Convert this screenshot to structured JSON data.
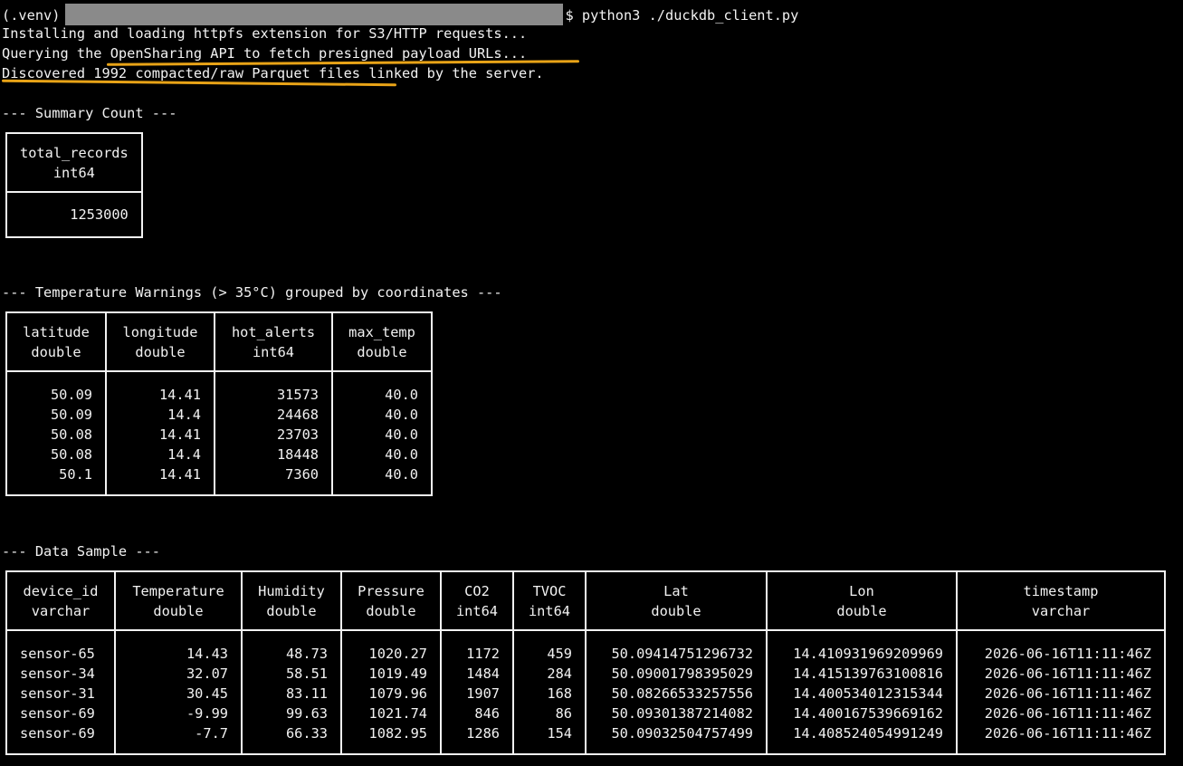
{
  "terminal": {
    "prompt_prefix": "(.venv)",
    "prompt_suffix": "$",
    "command": "python3 ./duckdb_client.py",
    "log_lines": [
      "Installing and loading httpfs extension for S3/HTTP requests...",
      "Querying the OpenSharing API to fetch presigned payload URLs...",
      "Discovered 1992 compacted/raw Parquet files linked by the server."
    ],
    "highlight_color": "#e8a317"
  },
  "summary": {
    "heading": "--- Summary Count ---",
    "column": {
      "name": "total_records",
      "type": "int64"
    },
    "value": "1253000"
  },
  "warnings": {
    "heading": "--- Temperature Warnings (> 35°C) grouped by coordinates ---",
    "columns": [
      {
        "name": "latitude",
        "type": "double"
      },
      {
        "name": "longitude",
        "type": "double"
      },
      {
        "name": "hot_alerts",
        "type": "int64"
      },
      {
        "name": "max_temp",
        "type": "double"
      }
    ],
    "rows": [
      [
        "50.09",
        "14.41",
        "31573",
        "40.0"
      ],
      [
        "50.09",
        "14.4",
        "24468",
        "40.0"
      ],
      [
        "50.08",
        "14.41",
        "23703",
        "40.0"
      ],
      [
        "50.08",
        "14.4",
        "18448",
        "40.0"
      ],
      [
        "50.1",
        "14.41",
        "7360",
        "40.0"
      ]
    ]
  },
  "sample": {
    "heading": "--- Data Sample ---",
    "columns": [
      {
        "name": "device_id",
        "type": "varchar"
      },
      {
        "name": "Temperature",
        "type": "double"
      },
      {
        "name": "Humidity",
        "type": "double"
      },
      {
        "name": "Pressure",
        "type": "double"
      },
      {
        "name": "CO2",
        "type": "int64"
      },
      {
        "name": "TVOC",
        "type": "int64"
      },
      {
        "name": "Lat",
        "type": "double"
      },
      {
        "name": "Lon",
        "type": "double"
      },
      {
        "name": "timestamp",
        "type": "varchar"
      }
    ],
    "rows": [
      [
        "sensor-65",
        "14.43",
        "48.73",
        "1020.27",
        "1172",
        "459",
        "50.09414751296732",
        "14.410931969209969",
        "2026-06-16T11:11:46Z"
      ],
      [
        "sensor-34",
        "32.07",
        "58.51",
        "1019.49",
        "1484",
        "284",
        "50.09001798395029",
        "14.415139763100816",
        "2026-06-16T11:11:46Z"
      ],
      [
        "sensor-31",
        "30.45",
        "83.11",
        "1079.96",
        "1907",
        "168",
        "50.08266533257556",
        "14.400534012315344",
        "2026-06-16T11:11:46Z"
      ],
      [
        "sensor-69",
        "-9.99",
        "99.63",
        "1021.74",
        "846",
        "86",
        "50.09301387214082",
        "14.400167539669162",
        "2026-06-16T11:11:46Z"
      ],
      [
        "sensor-69",
        "-7.7",
        "66.33",
        "1082.95",
        "1286",
        "154",
        "50.09032504757499",
        "14.408524054991249",
        "2026-06-16T11:11:46Z"
      ]
    ]
  }
}
